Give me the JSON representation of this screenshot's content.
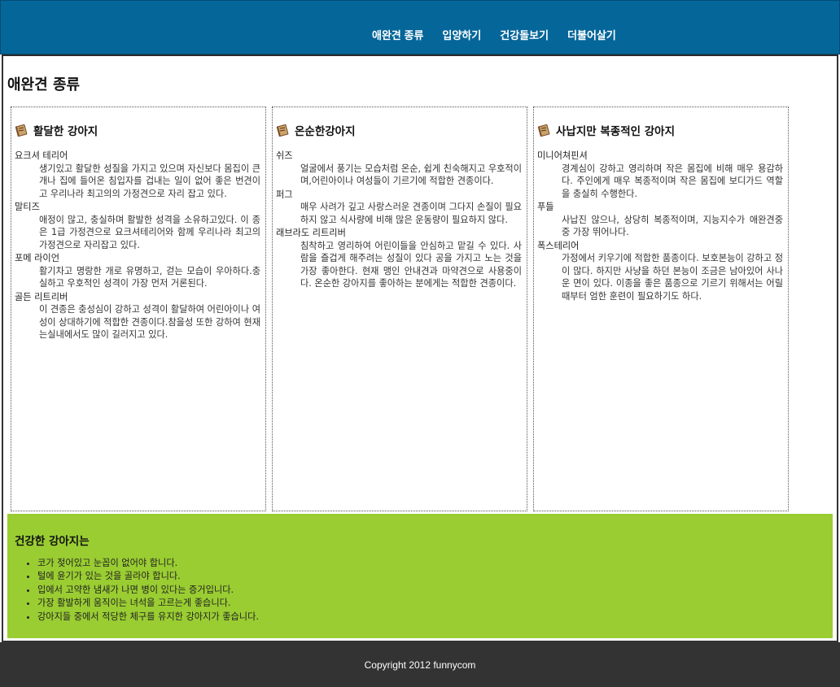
{
  "nav": {
    "items": [
      "애완견 종류",
      "입양하기",
      "건강돌보기",
      "더불어살기"
    ]
  },
  "page_title": "애완견 종류",
  "columns": [
    {
      "title": "활달한 강아지",
      "icon": "book-icon",
      "entries": [
        {
          "term": "요크셔 테리어",
          "desc": "생기있고 활달한 성질을 가지고 있으며 자신보다 몸집이 큰 개나 집에 들어온 침입자를 겁내는 일이 없어 좋은 번견이고 우리나라 최고의의 가정견으로 자리 잡고 있다."
        },
        {
          "term": "말티즈",
          "desc": "애정이 많고, 충실하며 활발한 성격을 소유하고있다. 이 종은 1급 가정견으로 요크셔테리어와 함께 우리나라 최고의 가정견으로 자리잡고 있다."
        },
        {
          "term": "포메 라이언",
          "desc": "활기차고 명랑한 개로 유명하고, 걷는 모습이 우아하다.충실하고 우호적인 성격이 가장 먼저 거론된다."
        },
        {
          "term": "골든 리트리버",
          "desc": "이 견종은 충성심이 강하고 성격이 활달하여 어린아이나 여성이 상대하기에 적합한 견종이다.참을성 또한 강하여 현재는실내에서도 많이 길러지고 있다."
        }
      ]
    },
    {
      "title": "온순한강아지",
      "icon": "book-icon",
      "entries": [
        {
          "term": "쉬즈",
          "desc": "얼굴에서 풍기는 모습처럼 온순, 쉽게 친숙해지고 우호적이며,어린아이나 여성들이 기르기에 적합한 견종이다."
        },
        {
          "term": "퍼그",
          "desc": "매우 사려가 깊고 사랑스러운 견종이며 그다지 손질이 필요하지 않고 식사량에 비해 많은 운동량이 필요하지 않다."
        },
        {
          "term": "래브라도 리트리버",
          "desc": "침착하고 영리하여 어린이들을 안심하고 맡길 수 있다. 사람을 즐겁게 해주려는 성질이 있다 공을 가지고 노는 것을 가장 좋아한다. 현재 맹인 안내견과 마약견으로 사용중이다. 온순한 강아지를 좋아하는 분에게는 적합한 견종이다."
        }
      ]
    },
    {
      "title": "사납지만 복종적인 강아지",
      "icon": "book-icon",
      "entries": [
        {
          "term": "미니어쳐핀셔",
          "desc": "경계심이 강하고 영리하며 작은 몸집에 비해 매우 용감하다. 주인에게 매우 복종적이며 작은 몸집에 보디가드 역할을 충실히 수행한다."
        },
        {
          "term": "푸들",
          "desc": "사납진 않으나, 상당히 복종적이며, 지능지수가 애완견중 중 가장 뛰어나다."
        },
        {
          "term": "폭스테리어",
          "desc": "가정에서 키우기에 적합한 품종이다. 보호본능이 강하고 정이 많다. 하지만 사냥을 하던 본능이 조금은 남아있어 사나운 면이 있다. 이종을 좋은 품종으로 기르기 위해서는 어릴 때부터 엄한 훈련이 필요하기도 하다."
        }
      ]
    }
  ],
  "health": {
    "title": "건강한 강아지는",
    "items": [
      "코가 젖어있고 눈꼽이 없어야 합니다.",
      "털에 윤기가 있는 것을 골라야 합니다.",
      "입에서 고약한 냄새가 나면 병이 있다는 증거입니다.",
      "가장 활발하게 움직이는 녀석을 고르는게 좋습니다.",
      "강아지들 중에서 적당한 체구를 유지한 강아지가 좋습니다."
    ]
  },
  "footer": {
    "copyright": "Copyright 2012 funnycom"
  },
  "colors": {
    "header_bg": "#05669a",
    "health_bg": "#9acd32",
    "footer_bg": "#333333"
  }
}
